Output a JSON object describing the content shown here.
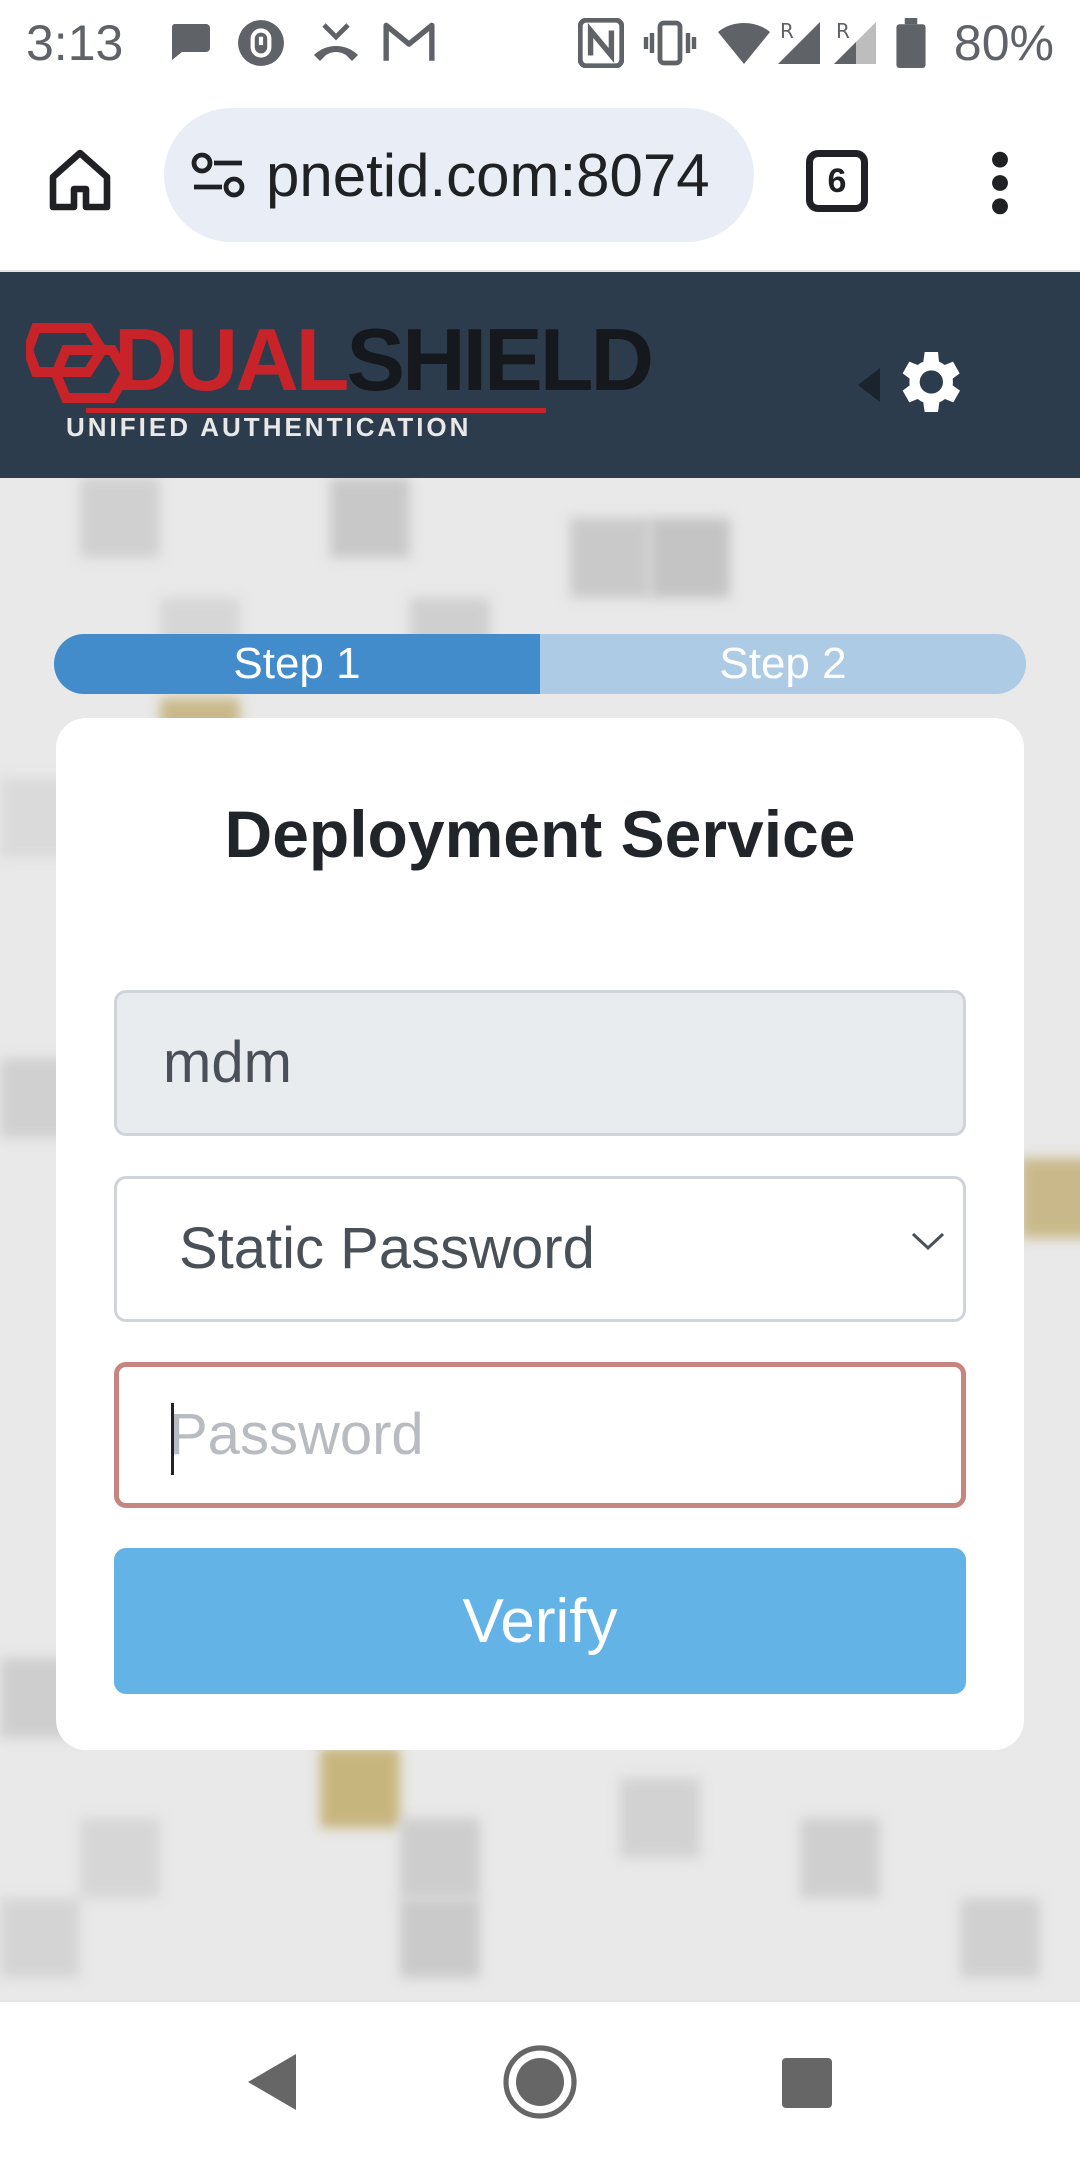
{
  "status_bar": {
    "time": "3:13",
    "battery_percent": "80%"
  },
  "browser": {
    "url": "pnetid.com:8074",
    "tab_count": "6"
  },
  "header": {
    "logo": {
      "dual": "DUAL",
      "shield": "SHIELD",
      "tagline": "UNIFIED AUTHENTICATION"
    }
  },
  "stepper": {
    "steps": [
      {
        "label": "Step 1",
        "active": true
      },
      {
        "label": "Step 2",
        "active": false
      }
    ]
  },
  "form": {
    "title": "Deployment Service",
    "username_value": "mdm",
    "method_selected": "Static Password",
    "password_placeholder": "Password",
    "verify_label": "Verify"
  },
  "colors": {
    "header_bg": "#2d3c4d",
    "brand_red": "#c9232a",
    "step_active": "#438ccb",
    "step_inactive": "#aecbe6",
    "button_blue": "#63b3e7",
    "password_border": "#c7857f"
  },
  "icons": [
    "chat-icon",
    "vpn-lock-icon",
    "missed-call-icon",
    "gmail-icon",
    "nfc-icon",
    "vibrate-icon",
    "wifi-icon",
    "signal-icon",
    "battery-icon",
    "home-icon",
    "site-settings-icon",
    "tabs-icon",
    "more-vert-icon",
    "gear-icon",
    "chevron-down-icon",
    "back-icon",
    "home-circle-icon",
    "recent-apps-icon"
  ]
}
